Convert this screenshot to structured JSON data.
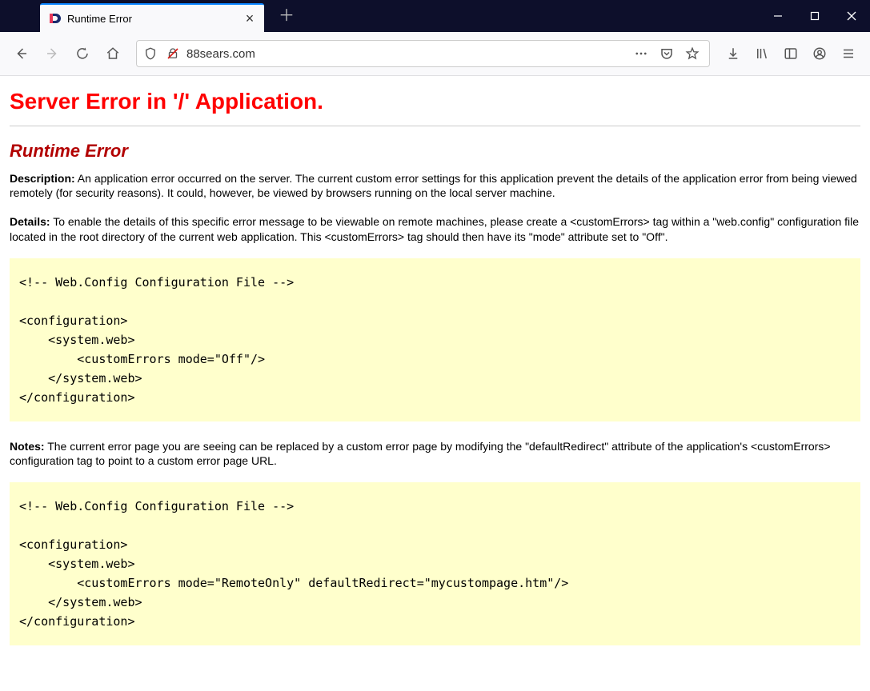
{
  "tab": {
    "title": "Runtime Error"
  },
  "addressbar": {
    "url": "88sears.com"
  },
  "page": {
    "h1": "Server Error in '/' Application.",
    "h2": "Runtime Error",
    "description_label": "Description:",
    "description_text": " An application error occurred on the server. The current custom error settings for this application prevent the details of the application error from being viewed remotely (for security reasons). It could, however, be viewed by browsers running on the local server machine.",
    "details_label": "Details:",
    "details_text": " To enable the details of this specific error message to be viewable on remote machines, please create a <customErrors> tag within a \"web.config\" configuration file located in the root directory of the current web application. This <customErrors> tag should then have its \"mode\" attribute set to \"Off\".",
    "code1": "<!-- Web.Config Configuration File -->\n\n<configuration>\n    <system.web>\n        <customErrors mode=\"Off\"/>\n    </system.web>\n</configuration>",
    "notes_label": "Notes:",
    "notes_text": " The current error page you are seeing can be replaced by a custom error page by modifying the \"defaultRedirect\" attribute of the application's <customErrors> configuration tag to point to a custom error page URL.",
    "code2": "<!-- Web.Config Configuration File -->\n\n<configuration>\n    <system.web>\n        <customErrors mode=\"RemoteOnly\" defaultRedirect=\"mycustompage.htm\"/>\n    </system.web>\n</configuration>"
  }
}
